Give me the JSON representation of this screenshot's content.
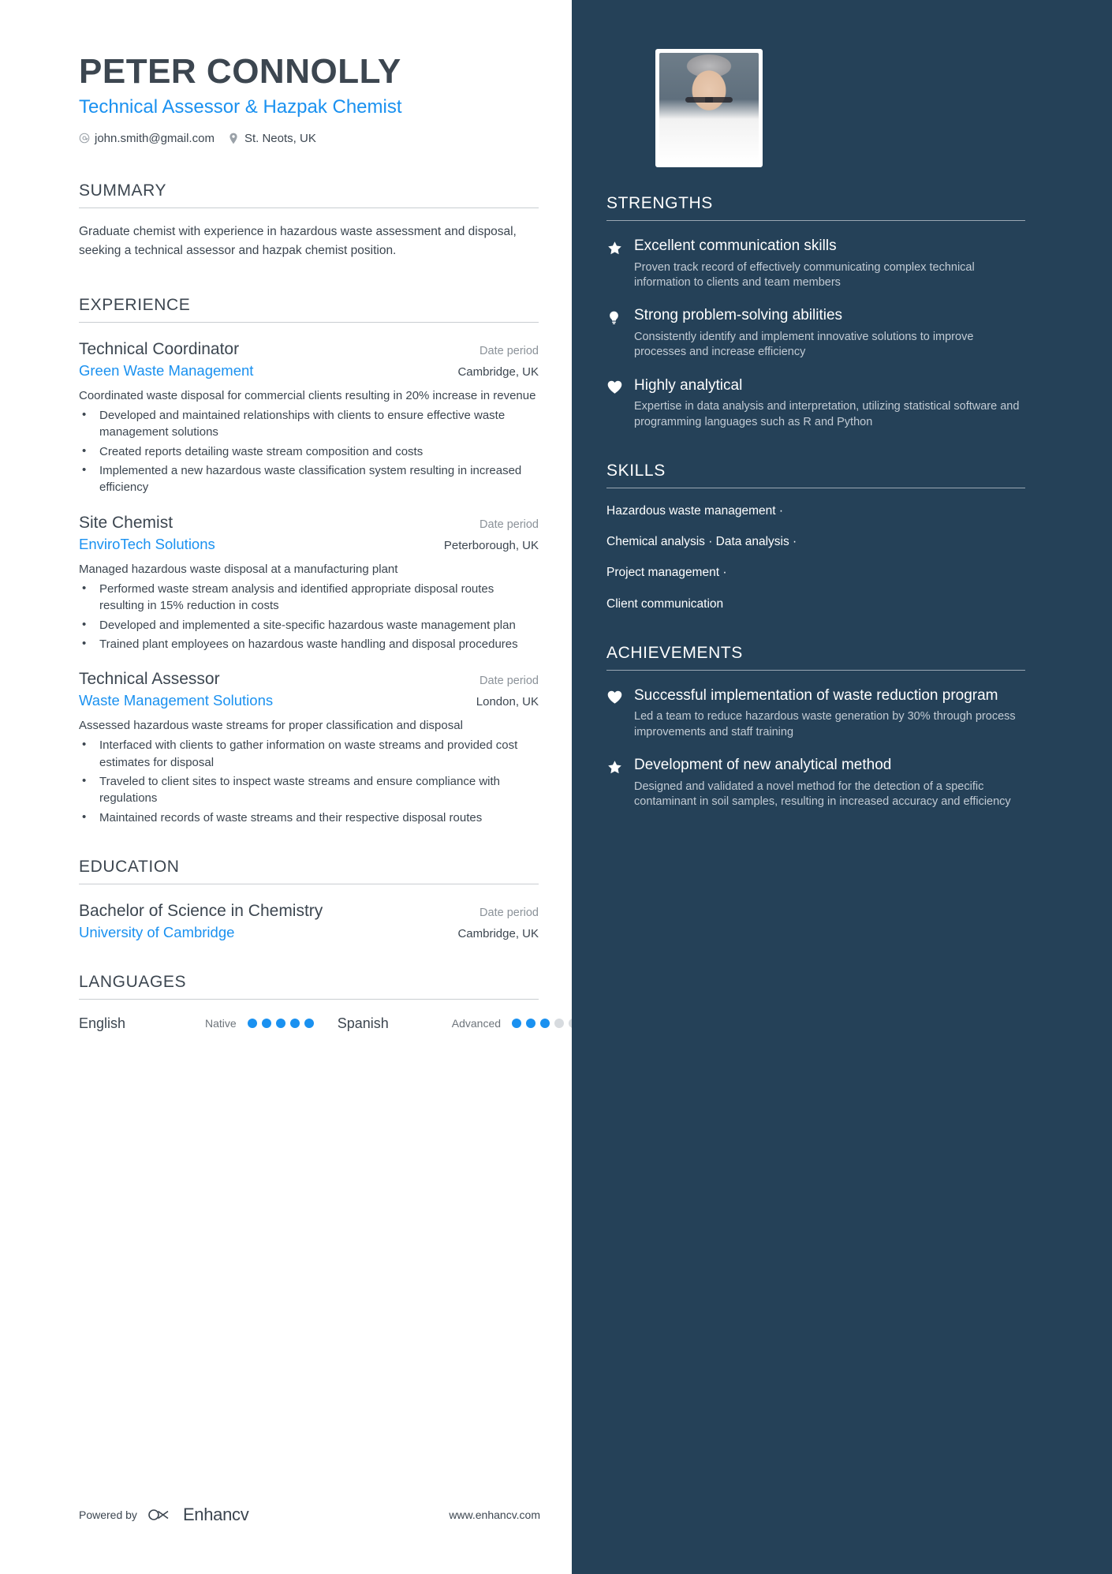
{
  "header": {
    "name": "PETER CONNOLLY",
    "headline": "Technical Assessor & Hazpak Chemist",
    "email": "john.smith@gmail.com",
    "location": "St. Neots, UK",
    "email_icon": "at-icon",
    "location_icon": "map-pin-icon"
  },
  "summary": {
    "title": "SUMMARY",
    "text": "Graduate chemist with experience in hazardous waste assessment and disposal, seeking a technical assessor and hazpak chemist position."
  },
  "experience": {
    "title": "EXPERIENCE",
    "entries": [
      {
        "title": "Technical Coordinator",
        "date": "Date period",
        "organization": "Green Waste Management",
        "location": "Cambridge, UK",
        "description": "Coordinated waste disposal for commercial clients resulting in 20% increase in revenue",
        "bullets": [
          "Developed and maintained relationships with clients to ensure effective waste management solutions",
          "Created reports detailing waste stream composition and costs",
          "Implemented a new hazardous waste classification system resulting in increased efficiency"
        ]
      },
      {
        "title": "Site Chemist",
        "date": "Date period",
        "organization": "EnviroTech Solutions",
        "location": "Peterborough, UK",
        "description": "Managed hazardous waste disposal at a manufacturing plant",
        "bullets": [
          "Performed waste stream analysis and identified appropriate disposal routes resulting in 15% reduction in costs",
          "Developed and implemented a site-specific hazardous waste management plan",
          "Trained plant employees on hazardous waste handling and disposal procedures"
        ]
      },
      {
        "title": "Technical Assessor",
        "date": "Date period",
        "organization": "Waste Management Solutions",
        "location": "London, UK",
        "description": "Assessed hazardous waste streams for proper classification and disposal",
        "bullets": [
          "Interfaced with clients to gather information on waste streams and provided cost estimates for disposal",
          "Traveled to client sites to inspect waste streams and ensure compliance with regulations",
          "Maintained records of waste streams and their respective disposal routes"
        ]
      }
    ]
  },
  "education": {
    "title": "EDUCATION",
    "entries": [
      {
        "title": "Bachelor of Science in Chemistry",
        "date": "Date period",
        "organization": "University of Cambridge",
        "location": "Cambridge, UK"
      }
    ]
  },
  "languages": {
    "title": "LANGUAGES",
    "items": [
      {
        "name": "English",
        "level": "Native",
        "filled": 5,
        "total": 5
      },
      {
        "name": "Spanish",
        "level": "Advanced",
        "filled": 3,
        "total": 5
      }
    ]
  },
  "strengths": {
    "title": "STRENGTHS",
    "items": [
      {
        "icon": "star-icon",
        "title": "Excellent communication skills",
        "desc": "Proven track record of effectively communicating complex technical information to clients and team members"
      },
      {
        "icon": "lightbulb-icon",
        "title": "Strong problem-solving abilities",
        "desc": "Consistently identify and implement innovative solutions to improve processes and increase efficiency"
      },
      {
        "icon": "heart-icon",
        "title": "Highly analytical",
        "desc": "Expertise in data analysis and interpretation, utilizing statistical software and programming languages such as R and Python"
      }
    ]
  },
  "skills": {
    "title": "SKILLS",
    "lines": [
      "Hazardous waste management ·",
      "Chemical analysis · Data analysis ·",
      "Project management ·",
      "Client communication"
    ]
  },
  "achievements": {
    "title": "ACHIEVEMENTS",
    "items": [
      {
        "icon": "heart-icon",
        "title": "Successful implementation of waste reduction program",
        "desc": "Led a team to reduce hazardous waste generation by 30% through process improvements and staff training"
      },
      {
        "icon": "star-icon",
        "title": "Development of new analytical method",
        "desc": "Designed and validated a novel method for the detection of a specific contaminant in soil samples, resulting in increased accuracy and efficiency"
      }
    ]
  },
  "footer": {
    "powered_by": "Powered by",
    "brand": "Enhancv",
    "website": "www.enhancv.com"
  },
  "colors": {
    "sidebar_bg": "#254158",
    "accent_blue": "#1a91f0",
    "text_dark": "#3c4650",
    "muted": "#8b9299"
  }
}
